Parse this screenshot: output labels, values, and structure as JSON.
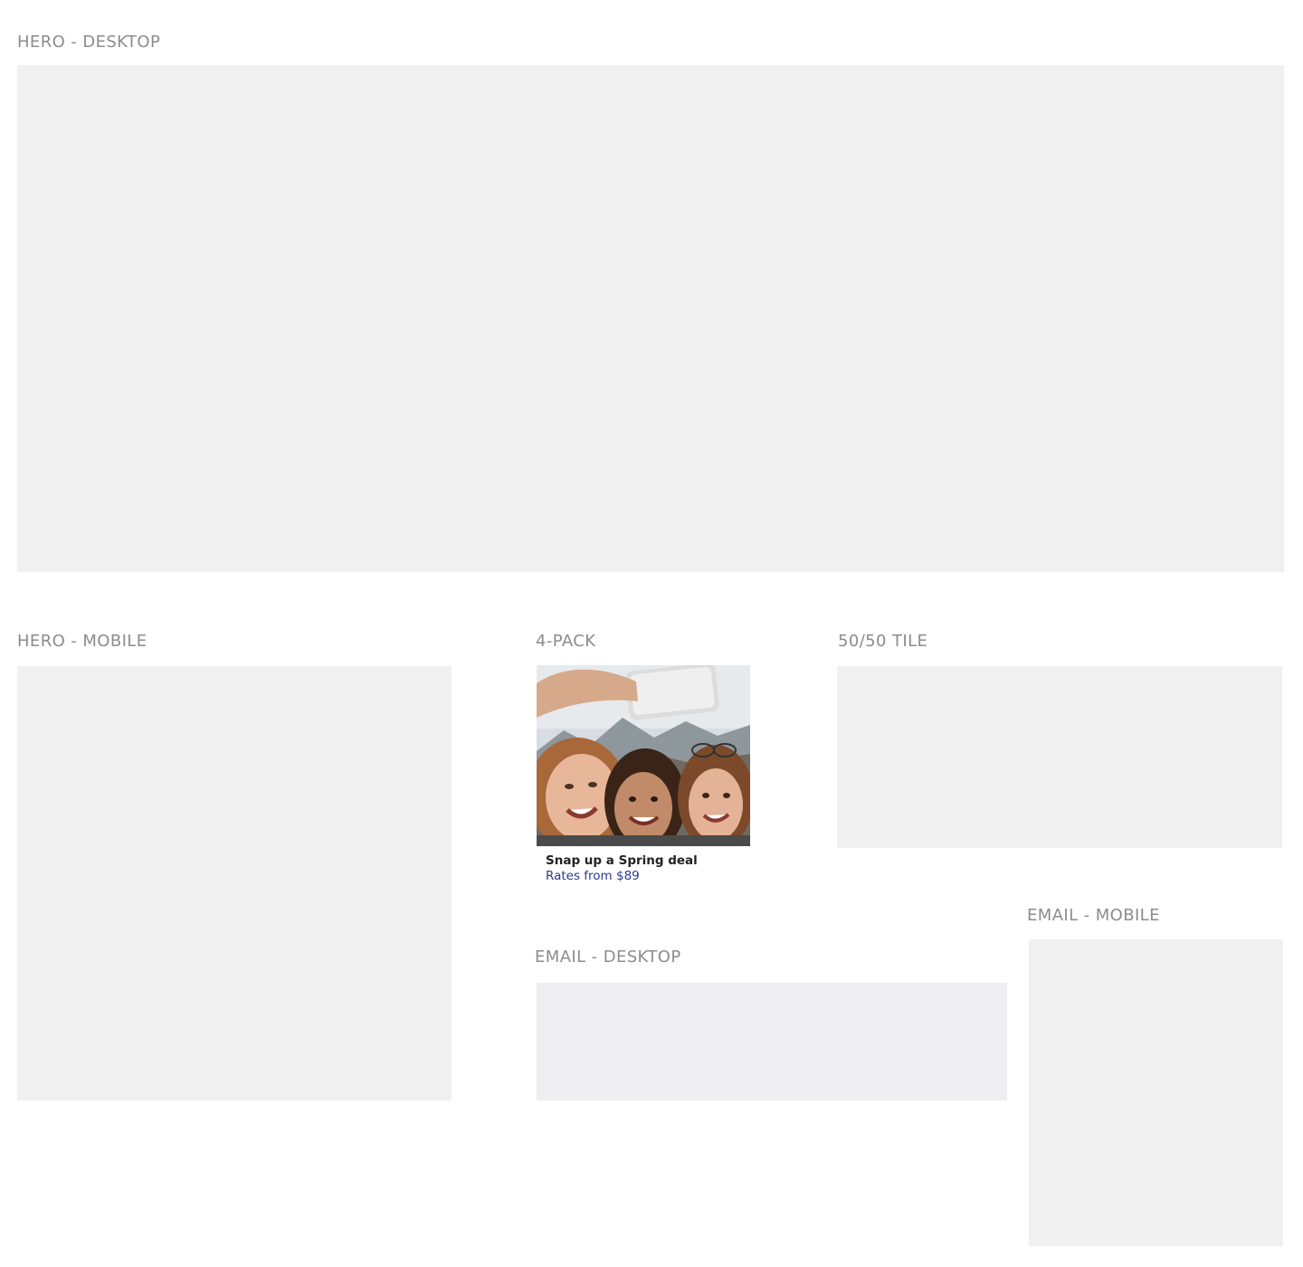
{
  "sections": {
    "hero_desktop": {
      "label": "HERO - DESKTOP"
    },
    "hero_mobile": {
      "label": "HERO - MOBILE"
    },
    "four_pack": {
      "label": "4-PACK",
      "card": {
        "title": "Snap up a Spring deal",
        "subtitle": "Rates from $89"
      }
    },
    "fifty_fifty": {
      "label": "50/50 TILE"
    },
    "email_desktop": {
      "label": "EMAIL - DESKTOP"
    },
    "email_mobile": {
      "label": "EMAIL - MOBILE"
    }
  },
  "colors": {
    "label": "#8c8c8c",
    "placeholder": "#f0f0f0",
    "link": "#2b3a8c"
  }
}
